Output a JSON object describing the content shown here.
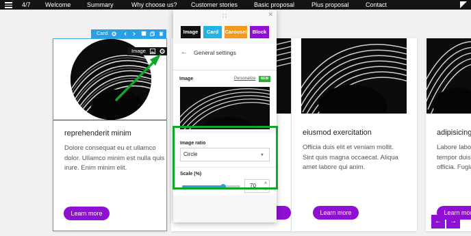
{
  "nav": {
    "counter": "4/7",
    "items": [
      "Welcome",
      "Summary",
      "Why choose us?",
      "Customer stories",
      "Basic proposal",
      "Plus proposal",
      "Contact"
    ]
  },
  "card_toolbar": {
    "label": "Card"
  },
  "image_toolbar": {
    "label": "Image"
  },
  "cards": [
    {
      "title": "reprehenderit minim",
      "body": "Dolore consequat eu et ullamco dolor. Ullamco minim est nulla quis irure. Enim minim elit.",
      "button": "Learn more"
    },
    {
      "title": "eiusmod exercitation",
      "body": "Officia duis elit et veniam mollit. Sint quis magna occaecat. Aliqua amet labore qui anim.",
      "button": "Learn more"
    },
    {
      "title": "adipisicing",
      "body": "Labore labore tempor duis officia. Fugia",
      "button": "Learn more"
    }
  ],
  "panel": {
    "block_types": [
      {
        "label": "Image",
        "color": "#111111"
      },
      {
        "label": "Card",
        "color": "#22b3e8"
      },
      {
        "label": "Carousel",
        "color": "#f39a1e"
      },
      {
        "label": "Block",
        "color": "#8f10d3"
      }
    ],
    "header": "General settings",
    "image_label": "Image",
    "personalize": "Personalize",
    "new_badge": "NEW",
    "ratio_label": "Image ratio",
    "ratio_value": "Circle",
    "scale_label": "Scale (%)",
    "scale_value": "70",
    "scale_fraction": 0.7
  },
  "colors": {
    "accent": "#8f10d3",
    "selection": "#2b9fe6",
    "highlight": "#11a62b"
  }
}
